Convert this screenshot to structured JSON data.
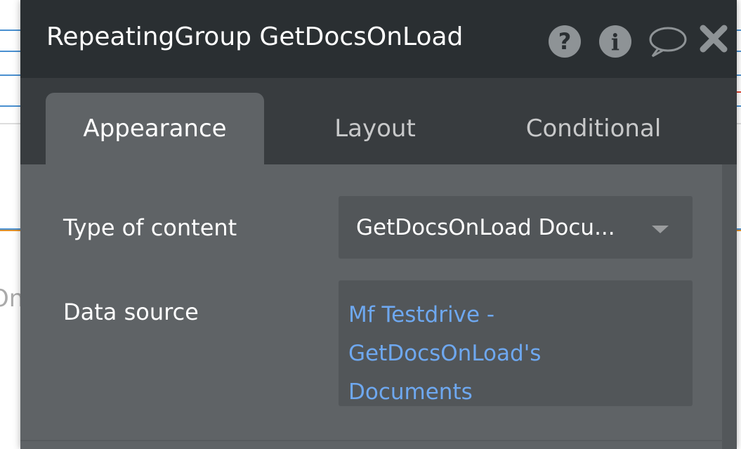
{
  "background": {
    "partial_text": "On"
  },
  "panel": {
    "title": "RepeatingGroup GetDocsOnLoad",
    "header_icons": [
      "help-icon",
      "info-icon",
      "comment-icon",
      "close-icon"
    ],
    "tabs": [
      {
        "label": "Appearance",
        "active": true
      },
      {
        "label": "Layout",
        "active": false
      },
      {
        "label": "Conditional",
        "active": false
      }
    ],
    "fields": {
      "type_of_content": {
        "label": "Type of content",
        "value": "GetDocsOnLoad Docu..."
      },
      "data_source": {
        "label": "Data source",
        "value": "Mf Testdrive - GetDocsOnLoad's Documents"
      }
    }
  },
  "colors": {
    "header": "#2a2f32",
    "tabbar": "#383c3f",
    "body": "#5f6366",
    "field": "#525659",
    "link": "#6ea8f0"
  }
}
